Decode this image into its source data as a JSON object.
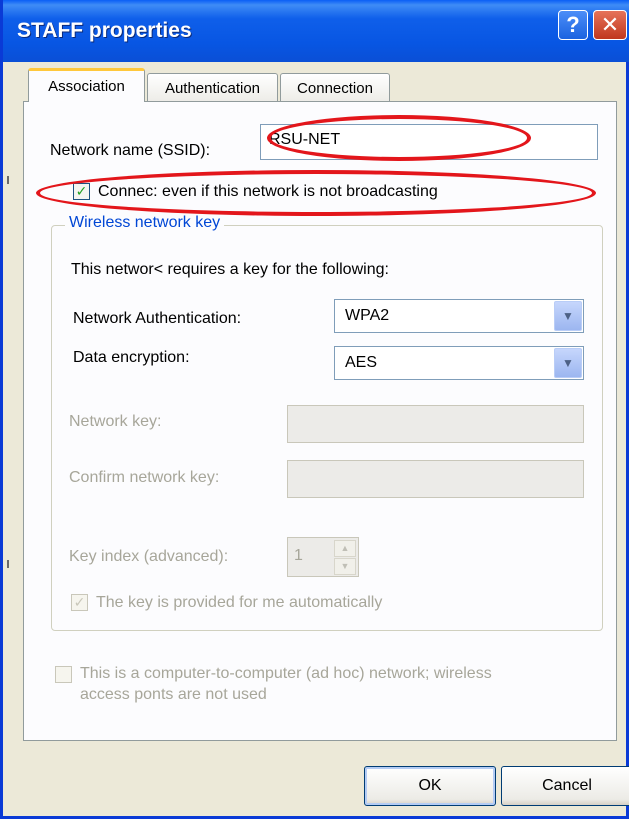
{
  "window": {
    "title": "STAFF properties",
    "help_glyph": "?",
    "close_glyph": "✕"
  },
  "tabs": [
    {
      "label": "Association",
      "selected": true
    },
    {
      "label": "Authentication",
      "selected": false
    },
    {
      "label": "Connection",
      "selected": false
    }
  ],
  "association": {
    "ssid_label": "Network name (SSID):",
    "ssid_value": "RSU-NET",
    "connect_even_label": "Connec: even if this network is not broadcasting",
    "connect_even_checked": true,
    "wireless_key_group_title": "Wireless network key",
    "requires_key_text": "This networ< requires a key for the following:",
    "net_auth_label": "Network Authentication:",
    "net_auth_value": "WPA2",
    "data_enc_label": "Data encryption:",
    "data_enc_value": "AES",
    "network_key_label": "Network key:",
    "confirm_key_label": "Confirm network key:",
    "key_index_label": "Key index (advanced):",
    "key_index_value": "1",
    "auto_key_label": "The key is provided for me automatically",
    "auto_key_checked": true,
    "adhoc_label_line1": "This is a computer-to-computer (ad hoc) network; wireless",
    "adhoc_label_line2": "access ponts are not used",
    "adhoc_checked": false
  },
  "buttons": {
    "ok": "OK",
    "cancel": "Cancel"
  },
  "colors": {
    "titlebar": "#0856e3",
    "annotation": "#e3161b",
    "dialog_bg": "#ece9d8"
  }
}
